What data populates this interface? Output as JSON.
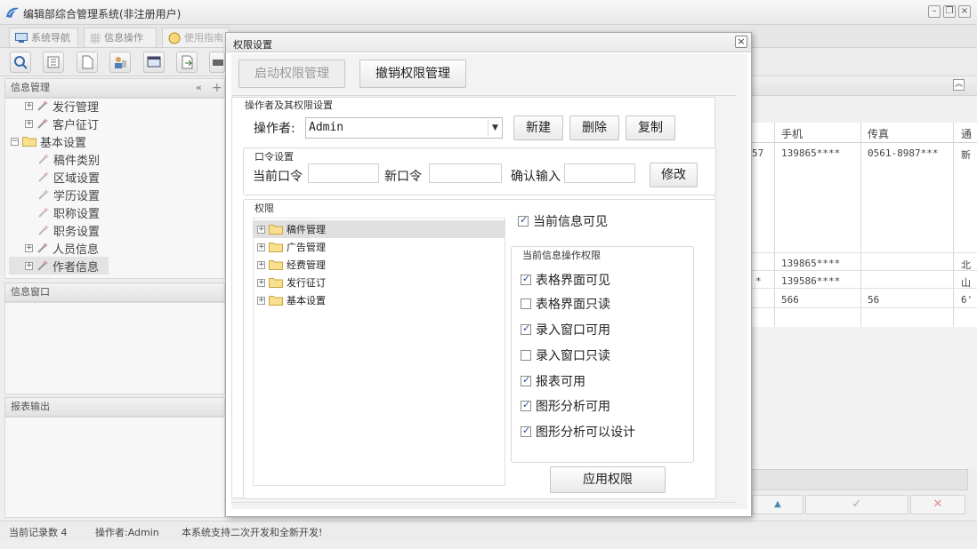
{
  "window": {
    "title": "编辑部综合管理系统(非注册用户)"
  },
  "tabs": [
    {
      "label": "系统导航",
      "icon": "monitor-icon"
    },
    {
      "label": "信息操作",
      "icon": "grid-icon"
    },
    {
      "label": "使用指南",
      "icon": "help-circle-icon"
    }
  ],
  "left": {
    "panel1_title": "信息管理",
    "tree": [
      {
        "label": "发行管理",
        "level": 1,
        "expand": "+",
        "icon": "wand-icon"
      },
      {
        "label": "客户征订",
        "level": 1,
        "expand": "+",
        "icon": "wand-icon"
      },
      {
        "label": "基本设置",
        "level": 0,
        "expand": "-",
        "icon": "folder-icon"
      },
      {
        "label": "稿件类别",
        "level": 2,
        "expand": "",
        "icon": "wand-icon"
      },
      {
        "label": "区域设置",
        "level": 2,
        "expand": "",
        "icon": "wand-icon"
      },
      {
        "label": "学历设置",
        "level": 2,
        "expand": "",
        "icon": "wand-icon"
      },
      {
        "label": "职称设置",
        "level": 2,
        "expand": "",
        "icon": "wand-icon"
      },
      {
        "label": "职务设置",
        "level": 2,
        "expand": "",
        "icon": "wand-icon"
      },
      {
        "label": "人员信息",
        "level": 1,
        "expand": "+",
        "icon": "wand-icon"
      },
      {
        "label": "作者信息",
        "level": 1,
        "expand": "+",
        "icon": "wand-icon"
      }
    ],
    "panel2_title": "信息窗口",
    "panel3_title": "报表输出"
  },
  "grid": {
    "headers": [
      "手机",
      "传真",
      "通"
    ],
    "rows": [
      [
        "57",
        "139865****",
        "0561-8987***",
        "新"
      ],
      [
        "",
        "139865****",
        "",
        "北"
      ],
      [
        "*",
        "139586****",
        "",
        "山"
      ],
      [
        "",
        "566",
        "56",
        "6'"
      ]
    ],
    "bottom_icons": [
      "up-arrow-icon",
      "check-icon",
      "x-icon"
    ]
  },
  "status": {
    "records": "当前记录数 4",
    "operator": "操作者:Admin",
    "note": "本系统支持二次开发和全新开发!"
  },
  "dialog": {
    "title": "权限设置",
    "btn_enable": "启动权限管理",
    "btn_revoke": "撤销权限管理",
    "section_title": "操作者及其权限设置",
    "operator_label": "操作者:",
    "operator_value": "Admin",
    "btn_new": "新建",
    "btn_delete": "删除",
    "btn_copy": "复制",
    "password_group": "口令设置",
    "current_pw_label": "当前口令",
    "new_pw_label": "新口令",
    "confirm_label": "确认输入",
    "btn_modify": "修改",
    "perm_group": "权限",
    "perm_tree": [
      "稿件管理",
      "广告管理",
      "经费管理",
      "发行征订",
      "基本设置"
    ],
    "current_visible_label": "当前信息可见",
    "current_visible_checked": true,
    "ops_group": "当前信息操作权限",
    "ops": [
      {
        "label": "表格界面可见",
        "checked": true
      },
      {
        "label": "表格界面只读",
        "checked": false
      },
      {
        "label": "录入窗口可用",
        "checked": true
      },
      {
        "label": "录入窗口只读",
        "checked": false
      },
      {
        "label": "报表可用",
        "checked": true
      },
      {
        "label": "图形分析可用",
        "checked": true
      },
      {
        "label": "图形分析可以设计",
        "checked": true
      }
    ],
    "btn_apply": "应用权限"
  }
}
